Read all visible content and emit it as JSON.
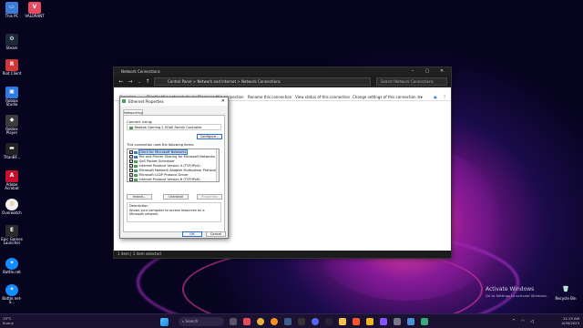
{
  "desktop": {
    "icons": [
      {
        "label": "This PC",
        "color": "#3b7bd6"
      },
      {
        "label": "VALORANT",
        "color": "#e84a5f"
      },
      {
        "label": "Steam",
        "color": "#1b2838"
      },
      {
        "label": "Riot Client",
        "color": "#d13639"
      },
      {
        "label": "Roblox Studio",
        "color": "#2f7be0"
      },
      {
        "label": "Roblox Player",
        "color": "#3b3b3b"
      },
      {
        "label": "TitanBF...",
        "color": "#222222"
      },
      {
        "label": "Adobe Acrobat",
        "color": "#c8102e"
      },
      {
        "label": "Overwatch",
        "color": "#f0f0f0"
      },
      {
        "label": "Epic Games Launcher",
        "color": "#2a2a2a"
      },
      {
        "label": "Battle.net",
        "color": "#148eff"
      },
      {
        "label": "Battle.net-S...",
        "color": "#148eff"
      }
    ],
    "recycle_bin": "Recycle Bin"
  },
  "explorer": {
    "title": "Network Connections",
    "address": [
      "Control Panel",
      "Network and Internet",
      "Network Connections"
    ],
    "search_placeholder": "Search Network Connections",
    "commands": [
      "Organize ▾",
      "Disable this network device",
      "Diagnose this connection",
      "Rename this connection",
      "View status of this connection",
      "Change settings of this connection"
    ],
    "status": "1 item  |  1 item selected"
  },
  "properties": {
    "title": "Ethernet Properties",
    "tab": "Networking",
    "connect_using_label": "Connect using:",
    "adapter": "Realtek Gaming 2.5GbE Family Controller",
    "configure": "Configure...",
    "items_label": "This connection uses the following items:",
    "items": [
      {
        "label": "Client for Microsoft Networks",
        "checked": true,
        "selected": true
      },
      {
        "label": "File and Printer Sharing for Microsoft Networks",
        "checked": true
      },
      {
        "label": "QoS Packet Scheduler",
        "checked": true
      },
      {
        "label": "Internet Protocol Version 4 (TCP/IPv4)",
        "checked": true
      },
      {
        "label": "Microsoft Network Adapter Multiplexor Protocol",
        "checked": false
      },
      {
        "label": "Microsoft LLDP Protocol Driver",
        "checked": true
      },
      {
        "label": "Internet Protocol Version 6 (TCP/IPv6)",
        "checked": true
      }
    ],
    "install": "Install...",
    "uninstall": "Uninstall",
    "properties_btn": "Properties",
    "description_label": "Description",
    "description": "Allows your computer to access resources on a Microsoft network.",
    "ok": "OK",
    "cancel": "Cancel"
  },
  "watermark": {
    "line1": "Activate Windows",
    "line2": "Go to Settings to activate Windows."
  },
  "taskbar": {
    "weather_temp": "13°C",
    "weather_text": "Sunny",
    "search_placeholder": "Search",
    "time": "11:15 AM",
    "date": "4/30/2023"
  }
}
